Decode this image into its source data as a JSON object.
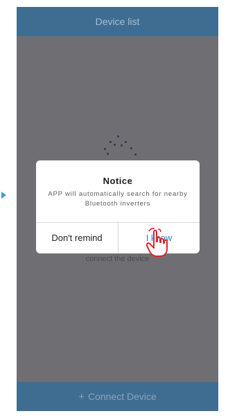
{
  "header": {
    "title": "Device list"
  },
  "main": {
    "hint_text": "connect the device"
  },
  "dialog": {
    "title": "Notice",
    "message": "APP will automatically search for nearby Bluetooth inverters",
    "dont_remind_label": "Don't remind",
    "i_know_label": "I know"
  },
  "footer": {
    "plus_icon": "+",
    "connect_label": "Connect Device"
  },
  "colors": {
    "header_bg": "#3f6d92",
    "overlay_bg": "#6f6f73",
    "accent_blue": "#2f7ec4",
    "hand_red": "#d8262c"
  },
  "icons": {
    "pointer": "hand-pointer-icon",
    "spinner": "loading-dots-icon",
    "arrow": "arrow-right-icon"
  }
}
